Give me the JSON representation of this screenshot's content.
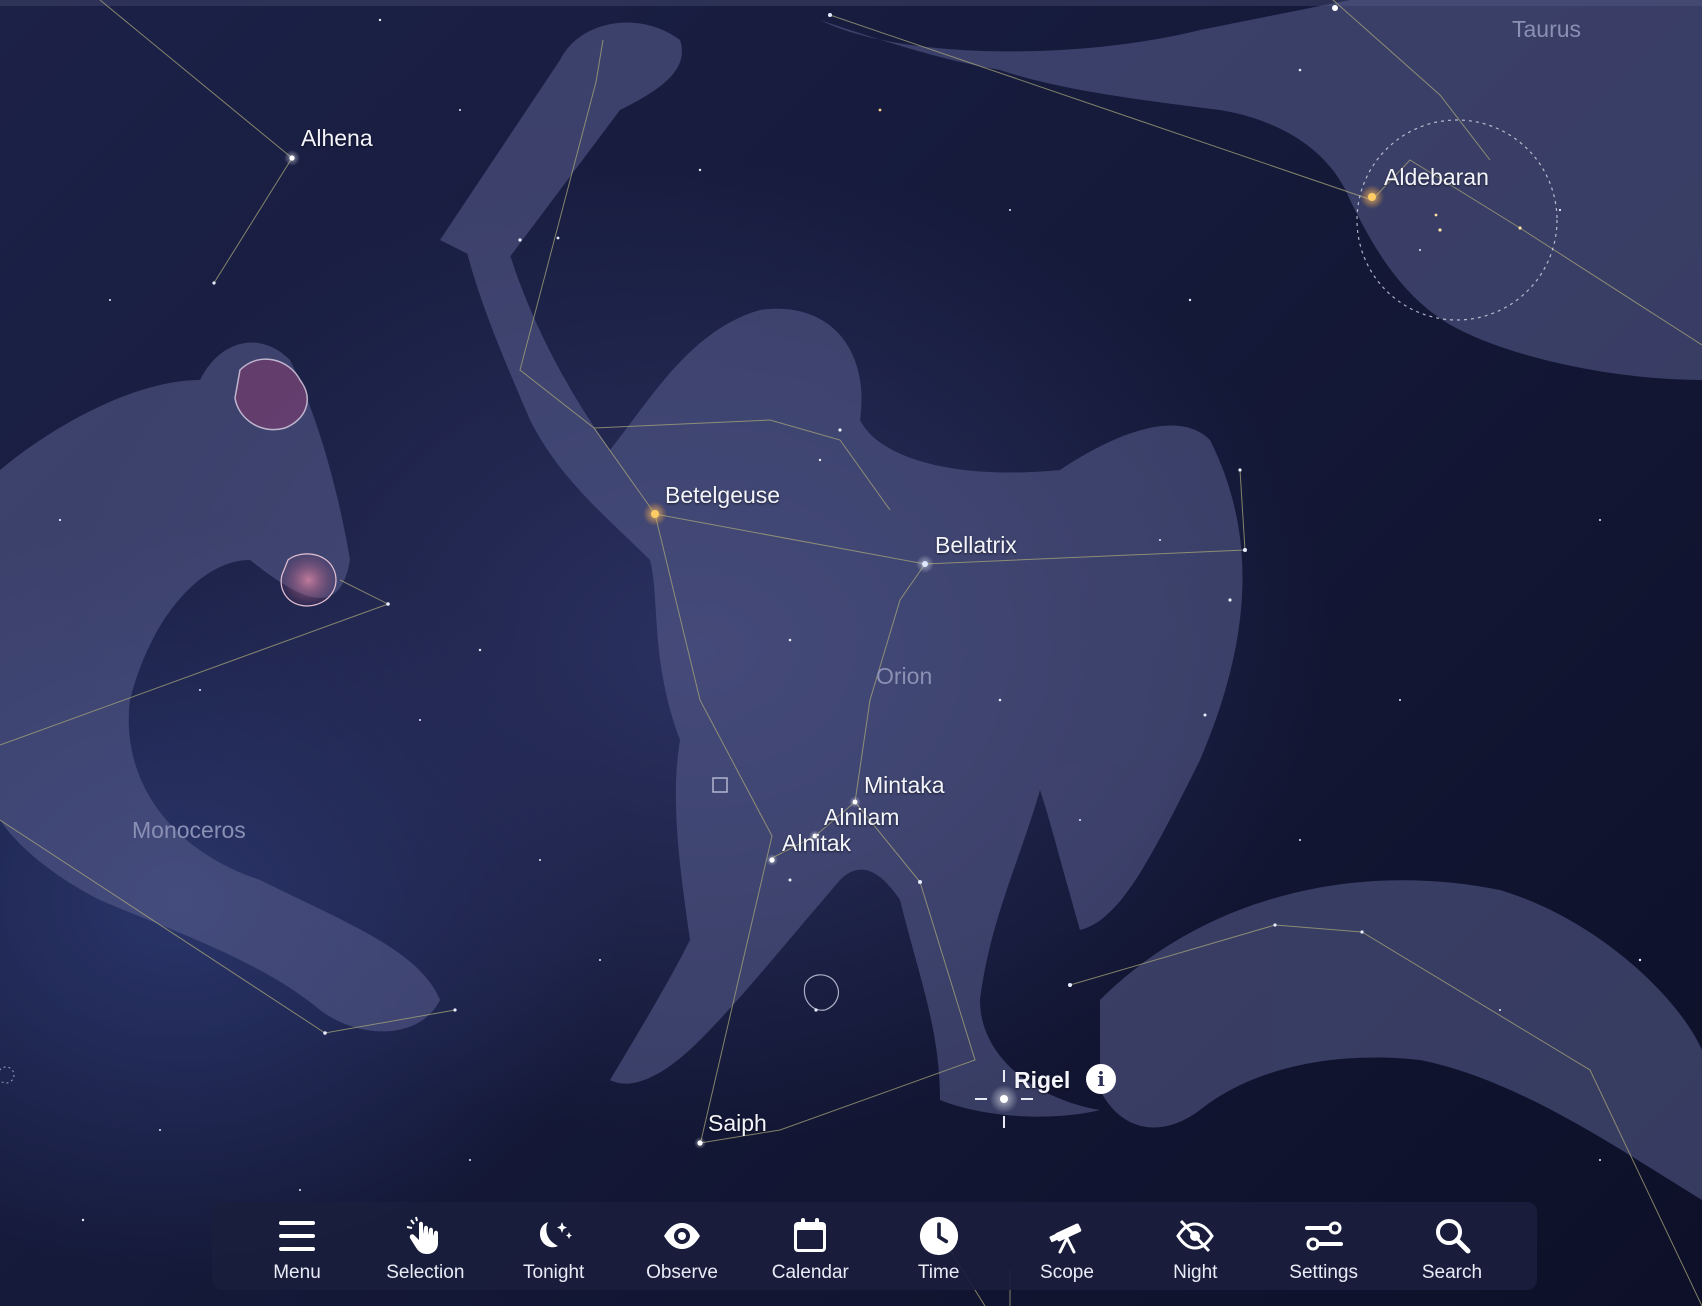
{
  "sky_view": {
    "star_labels": {
      "alhena": "Alhena",
      "betelgeuse": "Betelgeuse",
      "bellatrix": "Bellatrix",
      "aldebaran": "Aldebaran",
      "mintaka": "Mintaka",
      "alnilam": "Alnilam",
      "alnitak": "Alnitak",
      "saiph": "Saiph",
      "rigel": "Rigel"
    },
    "constellation_labels": {
      "taurus": "Taurus",
      "orion": "Orion",
      "monoceros": "Monoceros"
    },
    "selected_object_info_icon": "i"
  },
  "toolbar": {
    "items": [
      {
        "label": "Menu",
        "icon": "menu-icon"
      },
      {
        "label": "Selection",
        "icon": "selection-hand-icon"
      },
      {
        "label": "Tonight",
        "icon": "moon-stars-icon"
      },
      {
        "label": "Observe",
        "icon": "eye-icon"
      },
      {
        "label": "Calendar",
        "icon": "calendar-icon"
      },
      {
        "label": "Time",
        "icon": "clock-icon"
      },
      {
        "label": "Scope",
        "icon": "telescope-icon"
      },
      {
        "label": "Night",
        "icon": "night-vision-icon"
      },
      {
        "label": "Settings",
        "icon": "sliders-icon"
      },
      {
        "label": "Search",
        "icon": "search-icon"
      }
    ]
  },
  "colors": {
    "background": "#151a3a",
    "toolbar": "#1a1e3c",
    "star_label": "#f4f5fb",
    "constellation_label": "#8a8fb4",
    "constellation_line": "#a8a57a"
  }
}
